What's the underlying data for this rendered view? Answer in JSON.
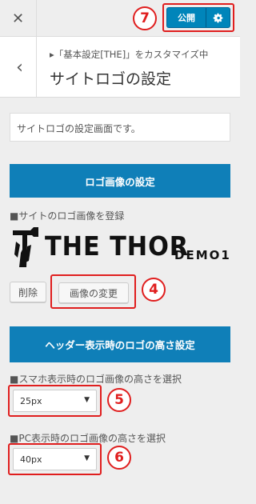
{
  "topbar": {
    "close_icon": "close-icon",
    "publish_label": "公開",
    "settings_icon": "gear-icon"
  },
  "header": {
    "breadcrumb": "▸「基本設定[THE]」をカスタマイズ中",
    "title": "サイトロゴの設定",
    "back_icon": "chevron-left-icon"
  },
  "description": "サイトロゴの設定画面です。",
  "logo_section": {
    "heading": "ロゴ画像の設定",
    "upload_label": "■サイトのロゴ画像を登録",
    "logo": {
      "main": "THE THOR",
      "sub": "DEMO1"
    },
    "remove_label": "削除",
    "change_label": "画像の変更"
  },
  "height_section": {
    "heading": "ヘッダー表示時のロゴの高さ設定",
    "sp_label": "■スマホ表示時のロゴ画像の高さを選択",
    "sp_value": "25px",
    "pc_label": "■PC表示時のロゴ画像の高さを選択",
    "pc_value": "40px"
  },
  "markers": {
    "m7": "7",
    "m4": "4",
    "m5": "5",
    "m6": "6"
  },
  "colors": {
    "accent": "#0f7fb8",
    "annotation": "#e01e1e"
  }
}
